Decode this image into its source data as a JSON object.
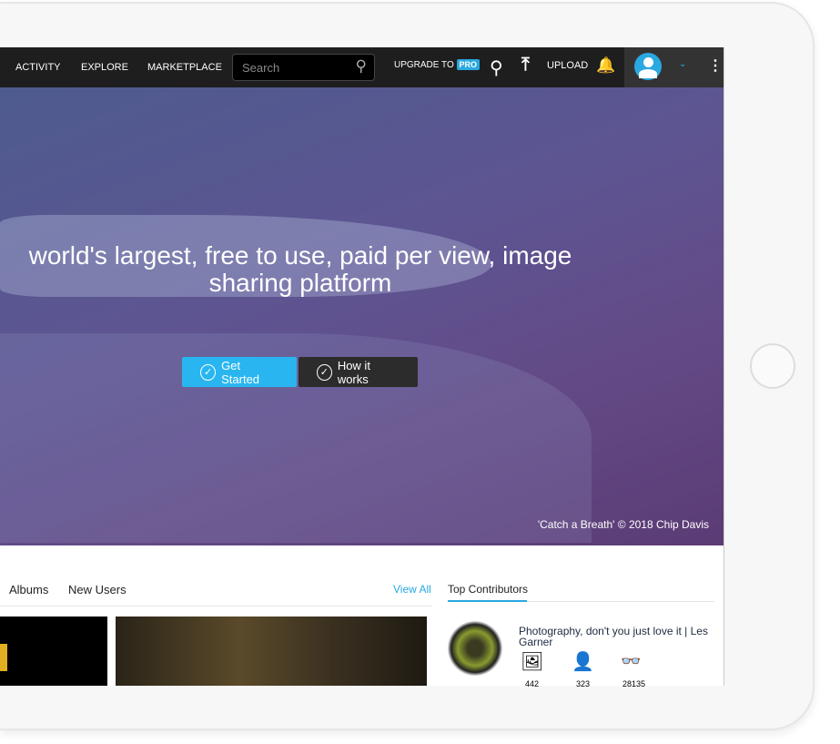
{
  "nav": {
    "items": [
      "ACTIVITY",
      "EXPLORE",
      "MARKETPLACE"
    ],
    "search_placeholder": "Search",
    "upgrade": "UPGRADE TO",
    "pro": "PRO",
    "upload": "UPLOAD"
  },
  "hero": {
    "headline": "world's largest, free to use, paid per view, image sharing platform",
    "get_started": "Get Started",
    "how_it_works": "How it works",
    "credit": "'Catch a Breath' © 2018 Chip Davis"
  },
  "content": {
    "tabs": [
      "Albums",
      "New Users"
    ],
    "view_all": "View All"
  },
  "contributors": {
    "title": "Top Contributors",
    "name": "Photography, don't you just love it | Les Garner",
    "images": "442",
    "followers": "323",
    "views": "28135"
  },
  "colors": {
    "accent": "#2aa8e0",
    "nav_bg": "#1e1e1e"
  }
}
